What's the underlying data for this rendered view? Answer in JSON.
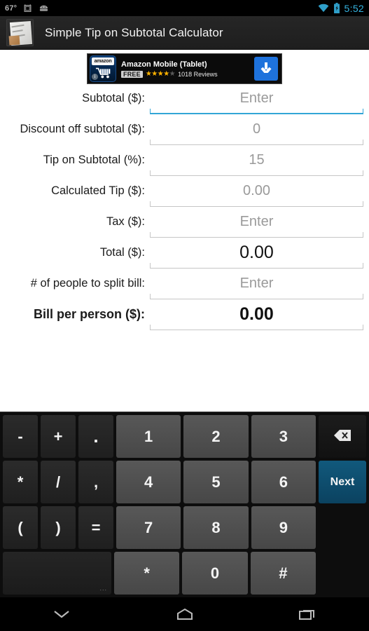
{
  "statusbar": {
    "temperature": "67°",
    "alarm_icon": "alarm-clock-icon",
    "app_icon": "android-robot-icon",
    "wifi_icon": "wifi-icon",
    "battery_icon": "battery-charging-icon",
    "clock": "5:52",
    "clock_color": "#35b3e0"
  },
  "actionbar": {
    "app_icon": "receipt-app-icon",
    "title": "Simple Tip on Subtotal Calculator"
  },
  "ad": {
    "icon": "amazon-cart-icon",
    "brand_label": "amazon",
    "info_glyph": "i",
    "title": "Amazon Mobile (Tablet)",
    "price_badge": "FREE",
    "stars_filled": "★★★★",
    "stars_empty": "★",
    "reviews": "1018 Reviews",
    "download_icon": "download-arrow-icon"
  },
  "form": {
    "rows": [
      {
        "label": "Subtotal ($):",
        "value": "Enter",
        "focused": true,
        "bold": false,
        "bold_value": false
      },
      {
        "label": "Discount off subtotal ($):",
        "value": "0",
        "focused": false,
        "bold": false,
        "bold_value": false
      },
      {
        "label": "Tip on Subtotal (%):",
        "value": "15",
        "focused": false,
        "bold": false,
        "bold_value": false
      },
      {
        "label": "Calculated Tip ($):",
        "value": "0.00",
        "focused": false,
        "bold": false,
        "bold_value": false
      },
      {
        "label": "Tax ($):",
        "value": "Enter",
        "focused": false,
        "bold": false,
        "bold_value": false
      },
      {
        "label": "Total ($):",
        "value": "0.00",
        "focused": false,
        "bold": false,
        "bold_value": true
      },
      {
        "label": "# of people to split bill:",
        "value": "Enter",
        "focused": false,
        "bold": false,
        "bold_value": false
      },
      {
        "label": "Bill per person ($):",
        "value": "0.00",
        "focused": false,
        "bold": true,
        "bold_value": true
      }
    ]
  },
  "keyboard": {
    "rows": [
      [
        {
          "label": "-",
          "type": "fn"
        },
        {
          "label": "+",
          "type": "fn"
        },
        {
          "label": ".",
          "type": "fn period"
        },
        {
          "label": "1",
          "type": "num"
        },
        {
          "label": "2",
          "type": "num"
        },
        {
          "label": "3",
          "type": "num"
        },
        {
          "label": "",
          "type": "side",
          "icon": "backspace-icon"
        }
      ],
      [
        {
          "label": "*",
          "type": "fn"
        },
        {
          "label": "/",
          "type": "fn"
        },
        {
          "label": ",",
          "type": "fn"
        },
        {
          "label": "4",
          "type": "num"
        },
        {
          "label": "5",
          "type": "num"
        },
        {
          "label": "6",
          "type": "num"
        },
        {
          "label": "Next",
          "type": "next"
        }
      ],
      [
        {
          "label": "(",
          "type": "fn"
        },
        {
          "label": ")",
          "type": "fn"
        },
        {
          "label": "=",
          "type": "fn"
        },
        {
          "label": "7",
          "type": "num"
        },
        {
          "label": "8",
          "type": "num"
        },
        {
          "label": "9",
          "type": "num"
        },
        {
          "label": "",
          "type": "gap"
        }
      ],
      [
        {
          "label": "",
          "type": "space",
          "hint": "..."
        },
        {
          "label": "*",
          "type": "num"
        },
        {
          "label": "0",
          "type": "num"
        },
        {
          "label": "#",
          "type": "num"
        },
        {
          "label": "",
          "type": "gap"
        }
      ]
    ]
  },
  "navbar": {
    "back_icon": "chevron-down-icon",
    "home_icon": "home-icon",
    "recents_icon": "recent-apps-icon"
  }
}
